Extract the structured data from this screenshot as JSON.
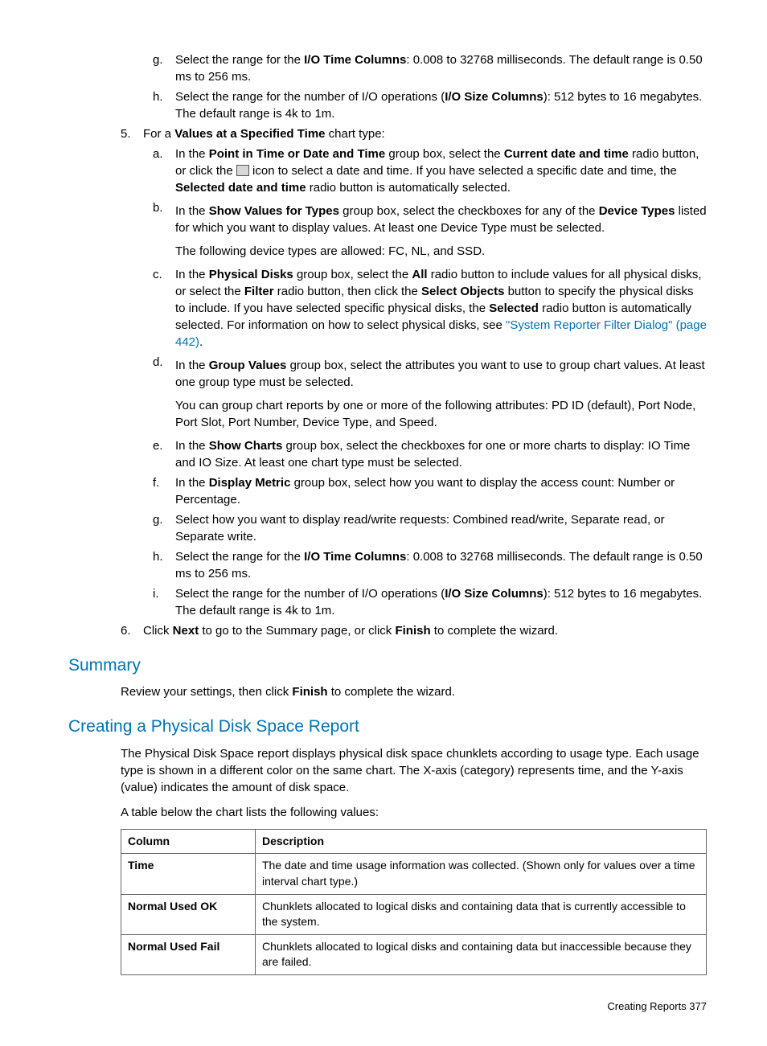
{
  "sub_g1": {
    "marker": "g.",
    "text_a": "Select the range for the ",
    "b1": "I/O Time Columns",
    "text_b": ": 0.008 to 32768 milliseconds. The default range is 0.50 ms to 256 ms."
  },
  "sub_h1": {
    "marker": "h.",
    "text_a": "Select the range for the number of I/O operations (",
    "b1": "I/O Size Columns",
    "text_b": "): 512 bytes to 16 megabytes. The default range is 4k to 1m."
  },
  "item5": {
    "marker": "5.",
    "text_a": "For a ",
    "b1": "Values at a Specified Time",
    "text_b": " chart type:"
  },
  "s5a": {
    "marker": "a.",
    "t1": "In the ",
    "b1": "Point in Time or Date and Time",
    "t2": " group box, select the ",
    "b2": "Current date and time",
    "t3": " radio button, or click the ",
    "t4": " icon to select a date and time. If you have selected a specific date and time, the ",
    "b3": "Selected date and time",
    "t5": " radio button is automatically selected."
  },
  "s5b": {
    "marker": "b.",
    "t1": "In the ",
    "b1": "Show Values for Types",
    "t2": " group box, select the checkboxes for any of the ",
    "b2": "Device Types",
    "t3": " listed for which you want to display values. At least one Device Type must be selected.",
    "note": "The following device types are allowed: FC, NL, and SSD."
  },
  "s5c": {
    "marker": "c.",
    "t1": "In the ",
    "b1": "Physical Disks",
    "t2": " group box, select the ",
    "b2": "All",
    "t3": " radio button to include values for all physical disks, or select the ",
    "b3": "Filter",
    "t4": " radio button, then click the ",
    "b4": "Select Objects",
    "t5": " button to specify the physical disks to include. If you have selected specific physical disks, the ",
    "b5": "Selected",
    "t6": " radio button is automatically selected. For information on how to select physical disks, see ",
    "link": "\"System Reporter Filter Dialog\" (page 442)",
    "t7": "."
  },
  "s5d": {
    "marker": "d.",
    "t1": "In the ",
    "b1": "Group Values",
    "t2": " group box, select the attributes you want to use to group chart values. At least one group type must be selected.",
    "note": "You can group chart reports by one or more of the following attributes: PD ID (default), Port Node, Port Slot, Port Number, Device Type, and Speed."
  },
  "s5e": {
    "marker": "e.",
    "t1": "In the ",
    "b1": "Show Charts",
    "t2": " group box, select the checkboxes for one or more charts to display: IO Time and IO Size. At least one chart type must be selected."
  },
  "s5f": {
    "marker": "f.",
    "t1": "In the ",
    "b1": "Display Metric",
    "t2": " group box, select how you want to display the access count: Number or Percentage."
  },
  "s5g": {
    "marker": "g.",
    "t1": "Select how you want to display read/write requests: Combined read/write, Separate read, or Separate write."
  },
  "s5h": {
    "marker": "h.",
    "t1": "Select the range for the ",
    "b1": "I/O Time Columns",
    "t2": ": 0.008 to 32768 milliseconds. The default range is 0.50 ms to 256 ms."
  },
  "s5i": {
    "marker": "i.",
    "t1": "Select the range for the number of I/O operations (",
    "b1": "I/O Size Columns",
    "t2": "): 512 bytes to 16 megabytes. The default range is 4k to 1m."
  },
  "item6": {
    "marker": "6.",
    "t1": "Click ",
    "b1": "Next",
    "t2": " to go to the Summary page, or click ",
    "b2": "Finish",
    "t3": " to complete the wizard."
  },
  "summary": {
    "heading": "Summary",
    "t1": "Review your settings, then click ",
    "b1": "Finish",
    "t2": " to complete the wizard."
  },
  "creating": {
    "heading": "Creating a Physical Disk Space Report",
    "p1": "The Physical Disk Space report displays physical disk space chunklets according to usage type. Each usage type is shown in a different color on the same chart. The X-axis (category) represents time, and the Y-axis (value) indicates the amount of disk space.",
    "p2": "A table below the chart lists the following values:"
  },
  "table": {
    "h1": "Column",
    "h2": "Description",
    "r1c1": "Time",
    "r1c2": "The date and time usage information was collected. (Shown only for values over a time interval chart type.)",
    "r2c1": "Normal Used OK",
    "r2c2": "Chunklets allocated to logical disks and containing data that is currently accessible to the system.",
    "r3c1": "Normal Used Fail",
    "r3c2": "Chunklets allocated to logical disks and containing data but inaccessible because they are failed."
  },
  "footer": "Creating Reports    377"
}
